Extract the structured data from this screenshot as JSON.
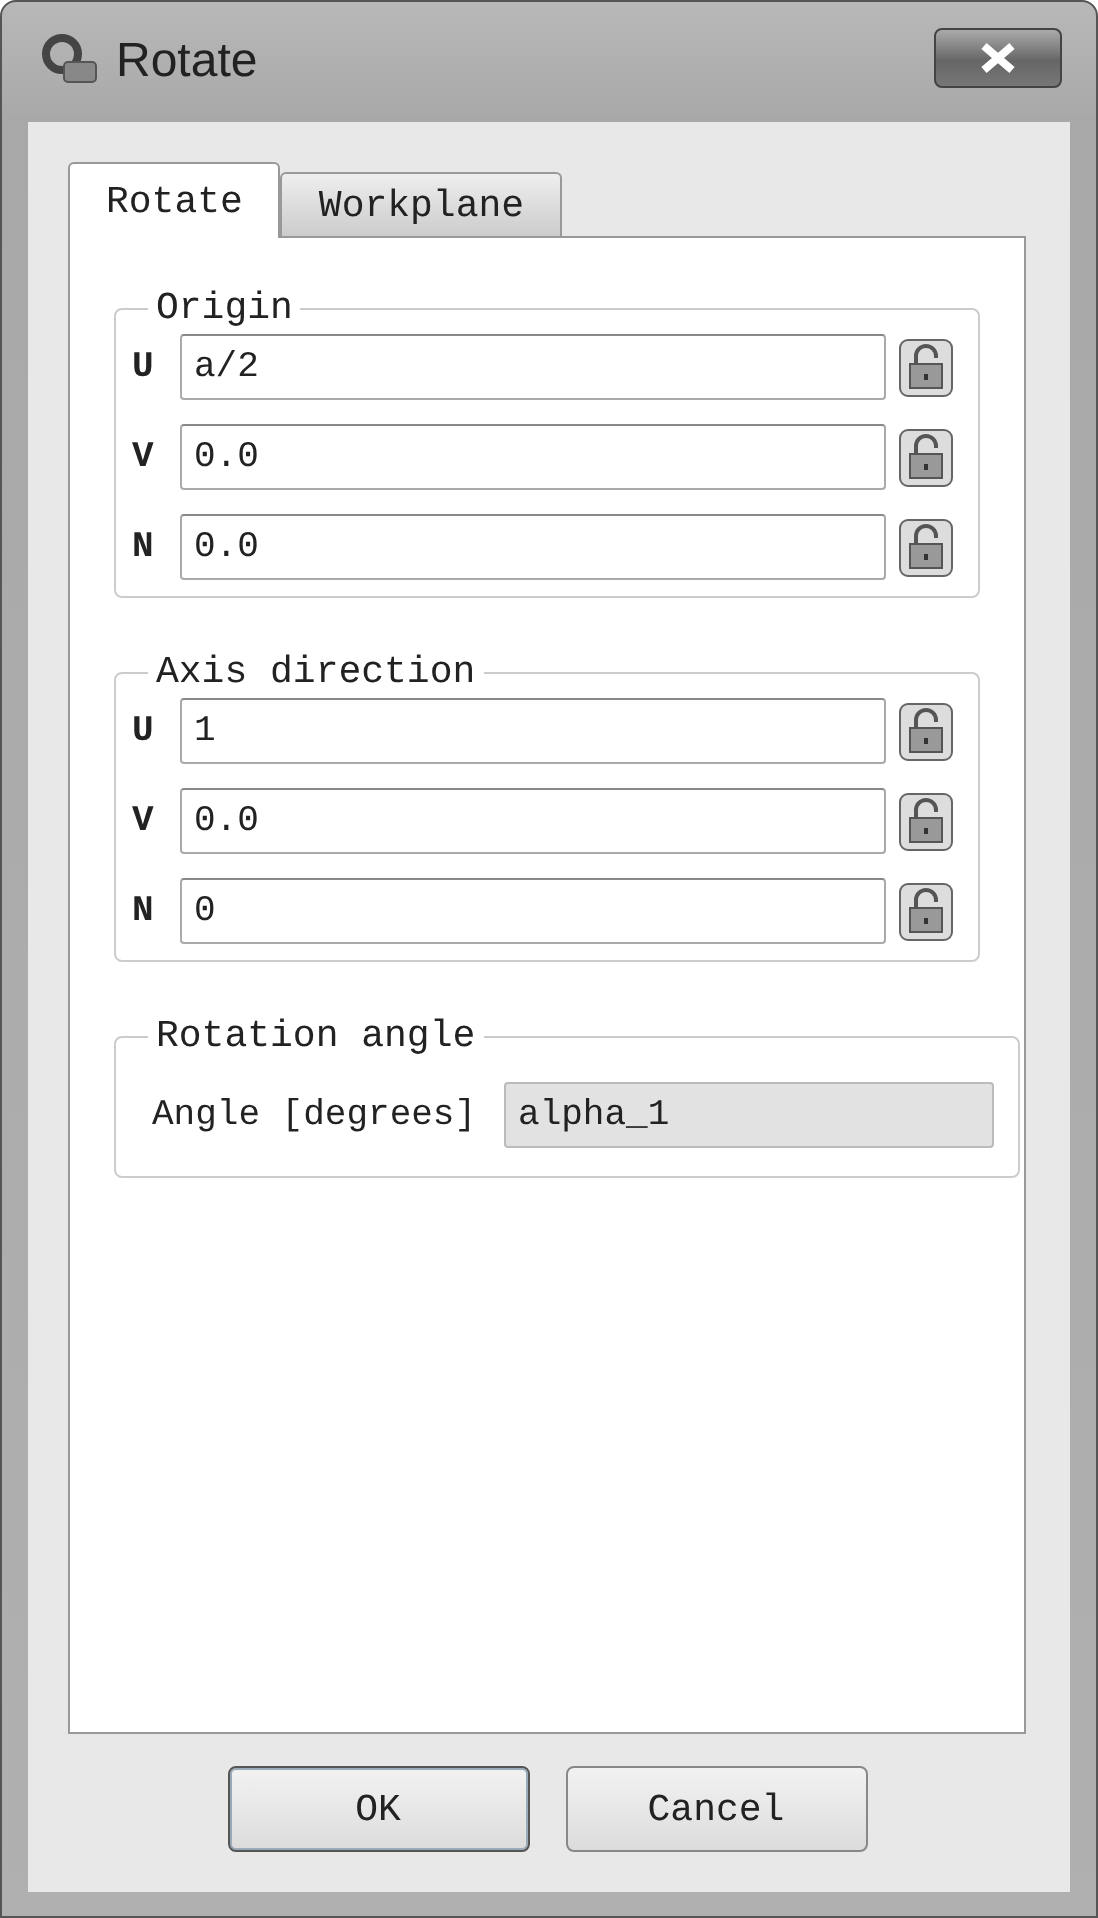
{
  "window": {
    "title": "Rotate"
  },
  "tabs": [
    {
      "label": "Rotate",
      "selected": true
    },
    {
      "label": "Workplane",
      "selected": false
    }
  ],
  "groups": [
    {
      "title": "Origin",
      "kind": "coordinates",
      "fields": [
        {
          "label": "U",
          "value": "a/2",
          "locked": false
        },
        {
          "label": "V",
          "value": "0.0",
          "locked": false
        },
        {
          "label": "N",
          "value": "0.0",
          "locked": false
        }
      ]
    },
    {
      "title": "Axis direction",
      "kind": "coordinates",
      "fields": [
        {
          "label": "U",
          "value": "1",
          "locked": false
        },
        {
          "label": "V",
          "value": "0.0",
          "locked": false
        },
        {
          "label": "N",
          "value": "0",
          "locked": false
        }
      ]
    },
    {
      "title": "Rotation angle",
      "kind": "angle",
      "label": "Angle [degrees]",
      "value": "alpha_1"
    }
  ],
  "buttons": [
    {
      "label": "OK",
      "default": true
    },
    {
      "label": "Cancel",
      "default": false
    }
  ]
}
